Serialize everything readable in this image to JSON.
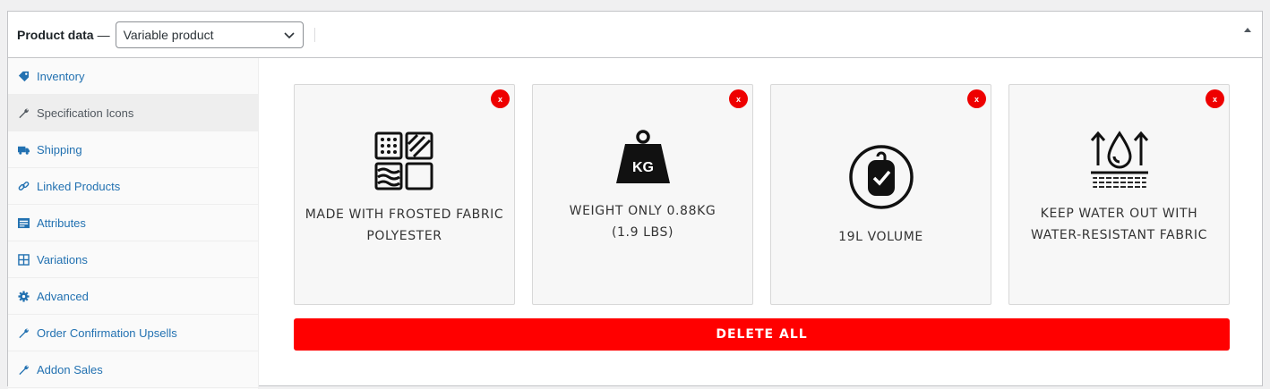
{
  "header": {
    "label": "Product data",
    "dash": "—",
    "product_type": "Variable product"
  },
  "sidebar": {
    "items": [
      {
        "label": "Inventory",
        "icon": "tag-icon"
      },
      {
        "label": "Specification Icons",
        "icon": "wrench-icon"
      },
      {
        "label": "Shipping",
        "icon": "truck-icon"
      },
      {
        "label": "Linked Products",
        "icon": "link-icon"
      },
      {
        "label": "Attributes",
        "icon": "list-icon"
      },
      {
        "label": "Variations",
        "icon": "grid-icon"
      },
      {
        "label": "Advanced",
        "icon": "gear-icon"
      },
      {
        "label": "Order Confirmation Upsells",
        "icon": "wrench-icon"
      },
      {
        "label": "Addon Sales",
        "icon": "wrench-icon"
      }
    ]
  },
  "cards": [
    {
      "line1": "MADE WITH FROSTED FABRIC",
      "line2": "POLYESTER",
      "icon": "fabric-icon",
      "close": "x"
    },
    {
      "line1": "WEIGHT ONLY 0.88KG",
      "line2": "(1.9 LBS)",
      "icon": "weight-kg-icon",
      "weight_label": "KG",
      "close": "x"
    },
    {
      "line1": "19L VOLUME",
      "line2": "",
      "icon": "backpack-volume-icon",
      "close": "x"
    },
    {
      "line1": "KEEP WATER OUT WITH",
      "line2": "WATER-RESISTANT FABRIC",
      "icon": "water-resistant-icon",
      "close": "x"
    }
  ],
  "delete_all_label": "DELETE ALL",
  "colors": {
    "accent": "#ff0000",
    "link": "#2271b1"
  }
}
